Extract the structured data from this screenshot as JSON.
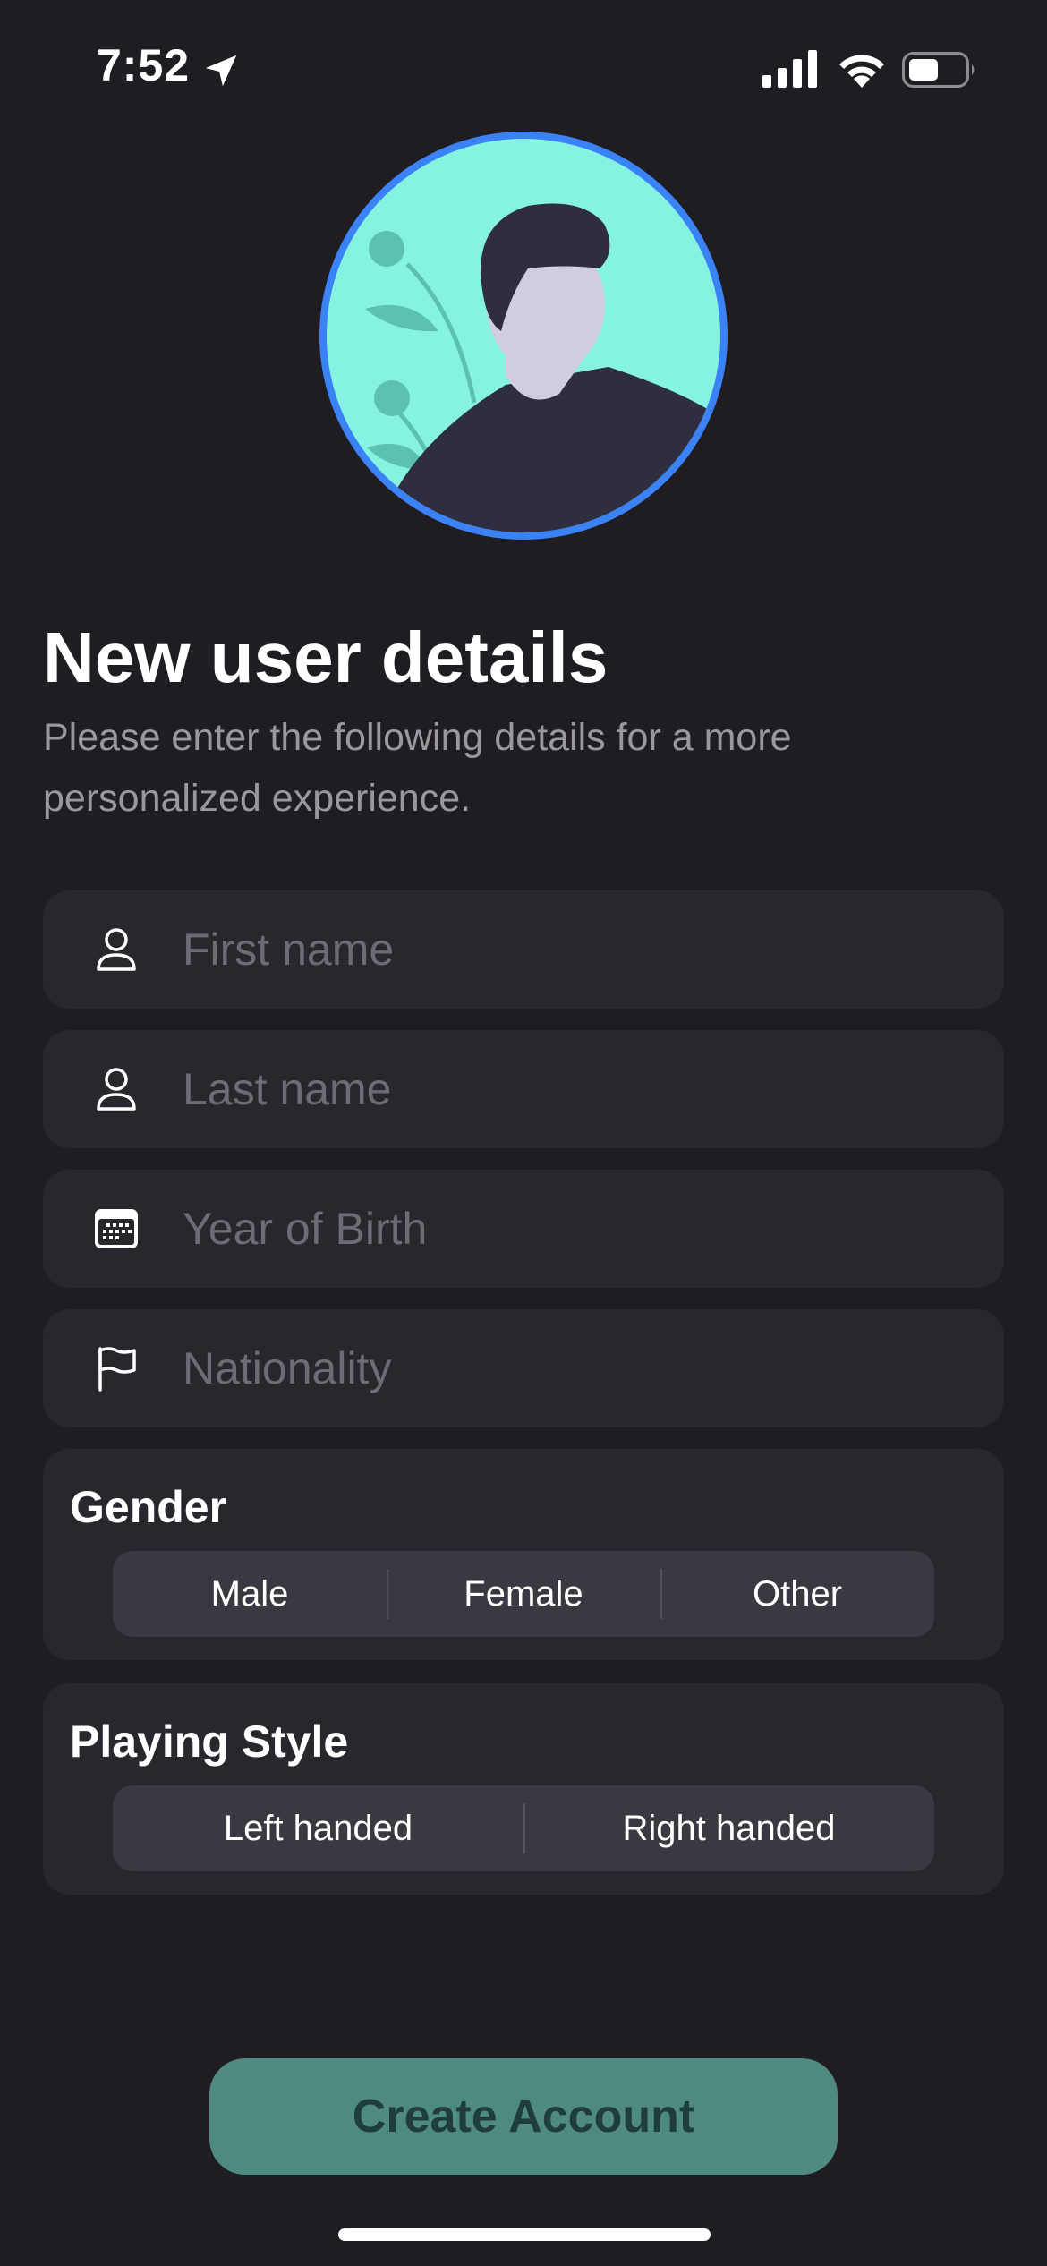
{
  "status_bar": {
    "time": "7:52",
    "icons": [
      "location-arrow-icon",
      "cellular-signal-icon",
      "wifi-icon",
      "battery-icon"
    ]
  },
  "avatar": {
    "icon": "person-avatar-illustration",
    "ring_color": "#3b82f6",
    "background_color": "#86f3e1"
  },
  "header": {
    "title": "New user details",
    "subtitle": "Please enter the following details for a more personalized experience."
  },
  "fields": {
    "first_name": {
      "icon": "person-icon",
      "placeholder": "First name",
      "value": ""
    },
    "last_name": {
      "icon": "person-icon",
      "placeholder": "Last name",
      "value": ""
    },
    "year_of_birth": {
      "icon": "calendar-icon",
      "placeholder": "Year of Birth",
      "value": ""
    },
    "nationality": {
      "icon": "flag-icon",
      "placeholder": "Nationality",
      "value": ""
    }
  },
  "gender": {
    "title": "Gender",
    "options": [
      "Male",
      "Female",
      "Other"
    ]
  },
  "playing_style": {
    "title": "Playing Style",
    "options": [
      "Left handed",
      "Right handed"
    ]
  },
  "create_button": {
    "label": "Create Account",
    "color": "#4f8a81"
  }
}
